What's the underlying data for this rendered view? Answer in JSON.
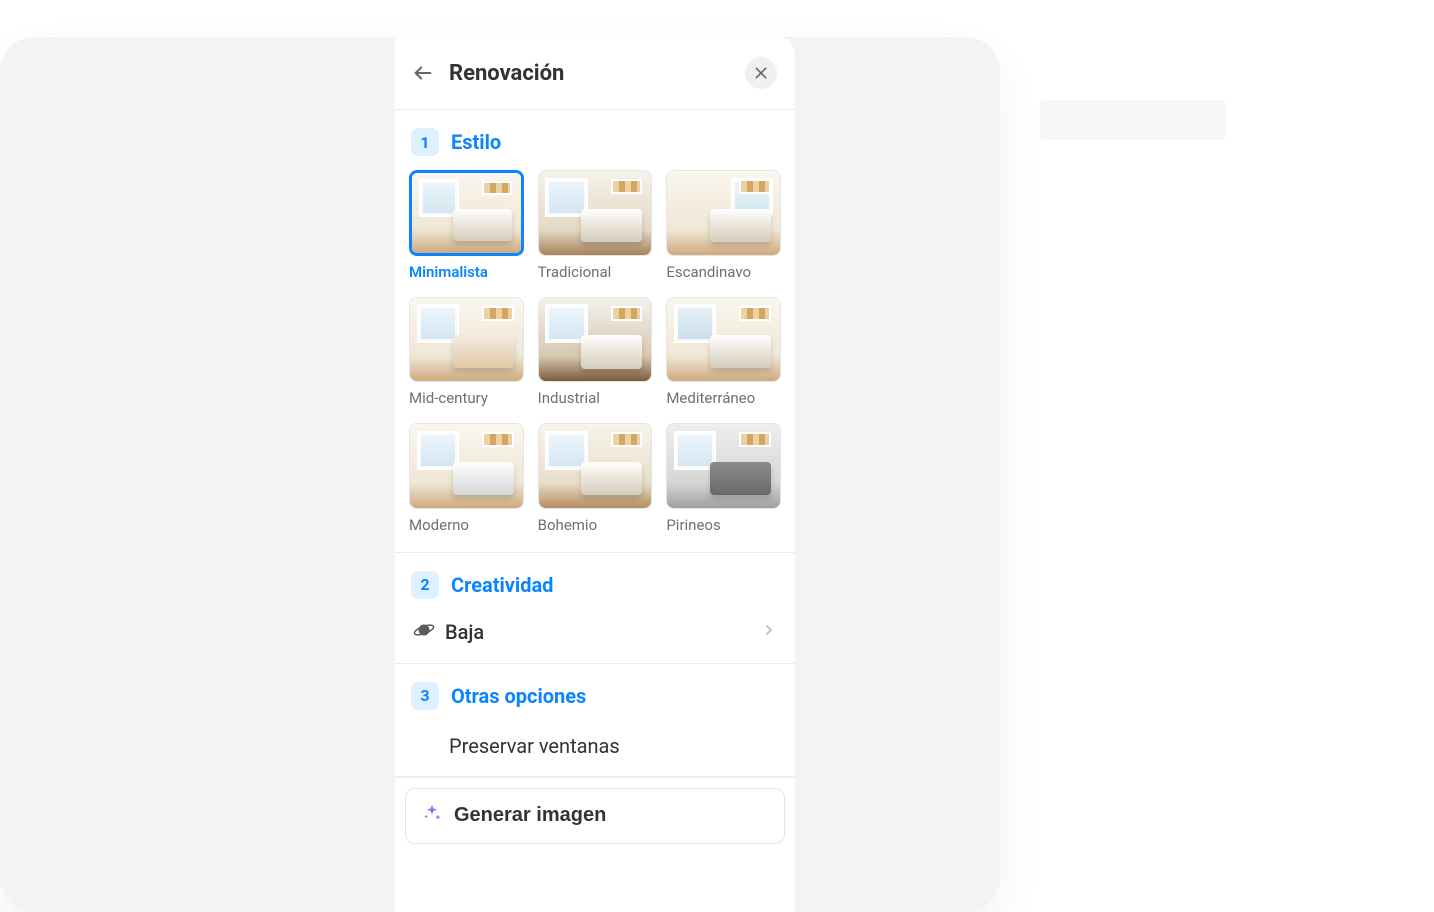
{
  "header": {
    "title": "Renovación"
  },
  "sections": {
    "style": {
      "step": "1",
      "title": "Estilo",
      "selected_index": 0,
      "options": [
        {
          "label": "Minimalista"
        },
        {
          "label": "Tradicional"
        },
        {
          "label": "Escandinavo"
        },
        {
          "label": "Mid-century"
        },
        {
          "label": "Industrial"
        },
        {
          "label": "Mediterráneo"
        },
        {
          "label": "Moderno"
        },
        {
          "label": "Bohemio"
        },
        {
          "label": "Pirineos"
        }
      ]
    },
    "creativity": {
      "step": "2",
      "title": "Creatividad",
      "value": "Baja"
    },
    "other": {
      "step": "3",
      "title": "Otras opciones",
      "preserve_windows_label": "Preservar ventanas"
    }
  },
  "footer": {
    "generate_label": "Generar imagen"
  }
}
